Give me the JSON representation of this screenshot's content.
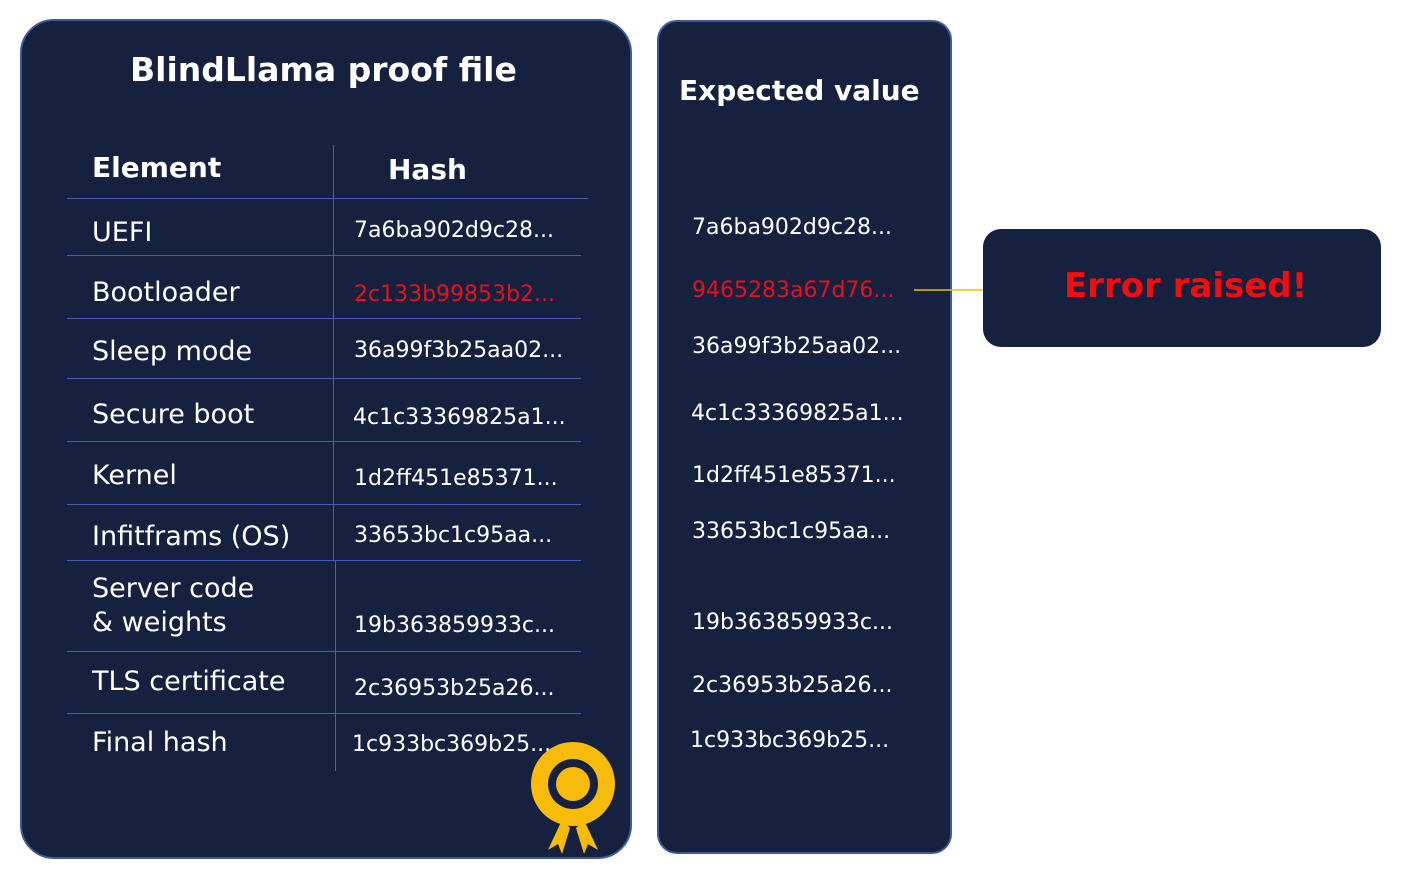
{
  "proof_file": {
    "title": "BlindLlama proof file",
    "headers": {
      "element": "Element",
      "hash": "Hash"
    },
    "rows": [
      {
        "element": "UEFI",
        "hash": "7a6ba902d9c28..."
      },
      {
        "element": "Bootloader",
        "hash": "2c133b99853b2..."
      },
      {
        "element": "Sleep mode",
        "hash": "36a99f3b25aa02..."
      },
      {
        "element": "Secure boot",
        "hash": "4c1c33369825a1..."
      },
      {
        "element": "Kernel",
        "hash": "1d2ff451e85371..."
      },
      {
        "element": "Infitframs (OS)",
        "hash": "33653bc1c95aa..."
      },
      {
        "element": "Server code\n& weights",
        "hash": "19b363859933c..."
      },
      {
        "element": "TLS certificate",
        "hash": "2c36953b25a26..."
      },
      {
        "element": "Final hash",
        "hash": "1c933bc369b25..."
      }
    ],
    "badge_icon": "certificate-badge-icon"
  },
  "expected": {
    "title": "Expected value",
    "values": [
      "7a6ba902d9c28...",
      "9465283a67d76...",
      "36a99f3b25aa02...",
      "4c1c33369825a1...",
      "1d2ff451e85371...",
      "33653bc1c95aa...",
      "19b363859933c...",
      "2c36953b25a26...",
      "1c933bc369b25..."
    ]
  },
  "error": {
    "text": "Error raised!",
    "arrow_icon": "arrow-right-icon"
  },
  "colors": {
    "panel_bg": "#15213f",
    "panel_border": "#3d5a96",
    "grid_line": "#3f63b8",
    "mismatch": "#e8101a",
    "accent": "#f7bb0a"
  }
}
